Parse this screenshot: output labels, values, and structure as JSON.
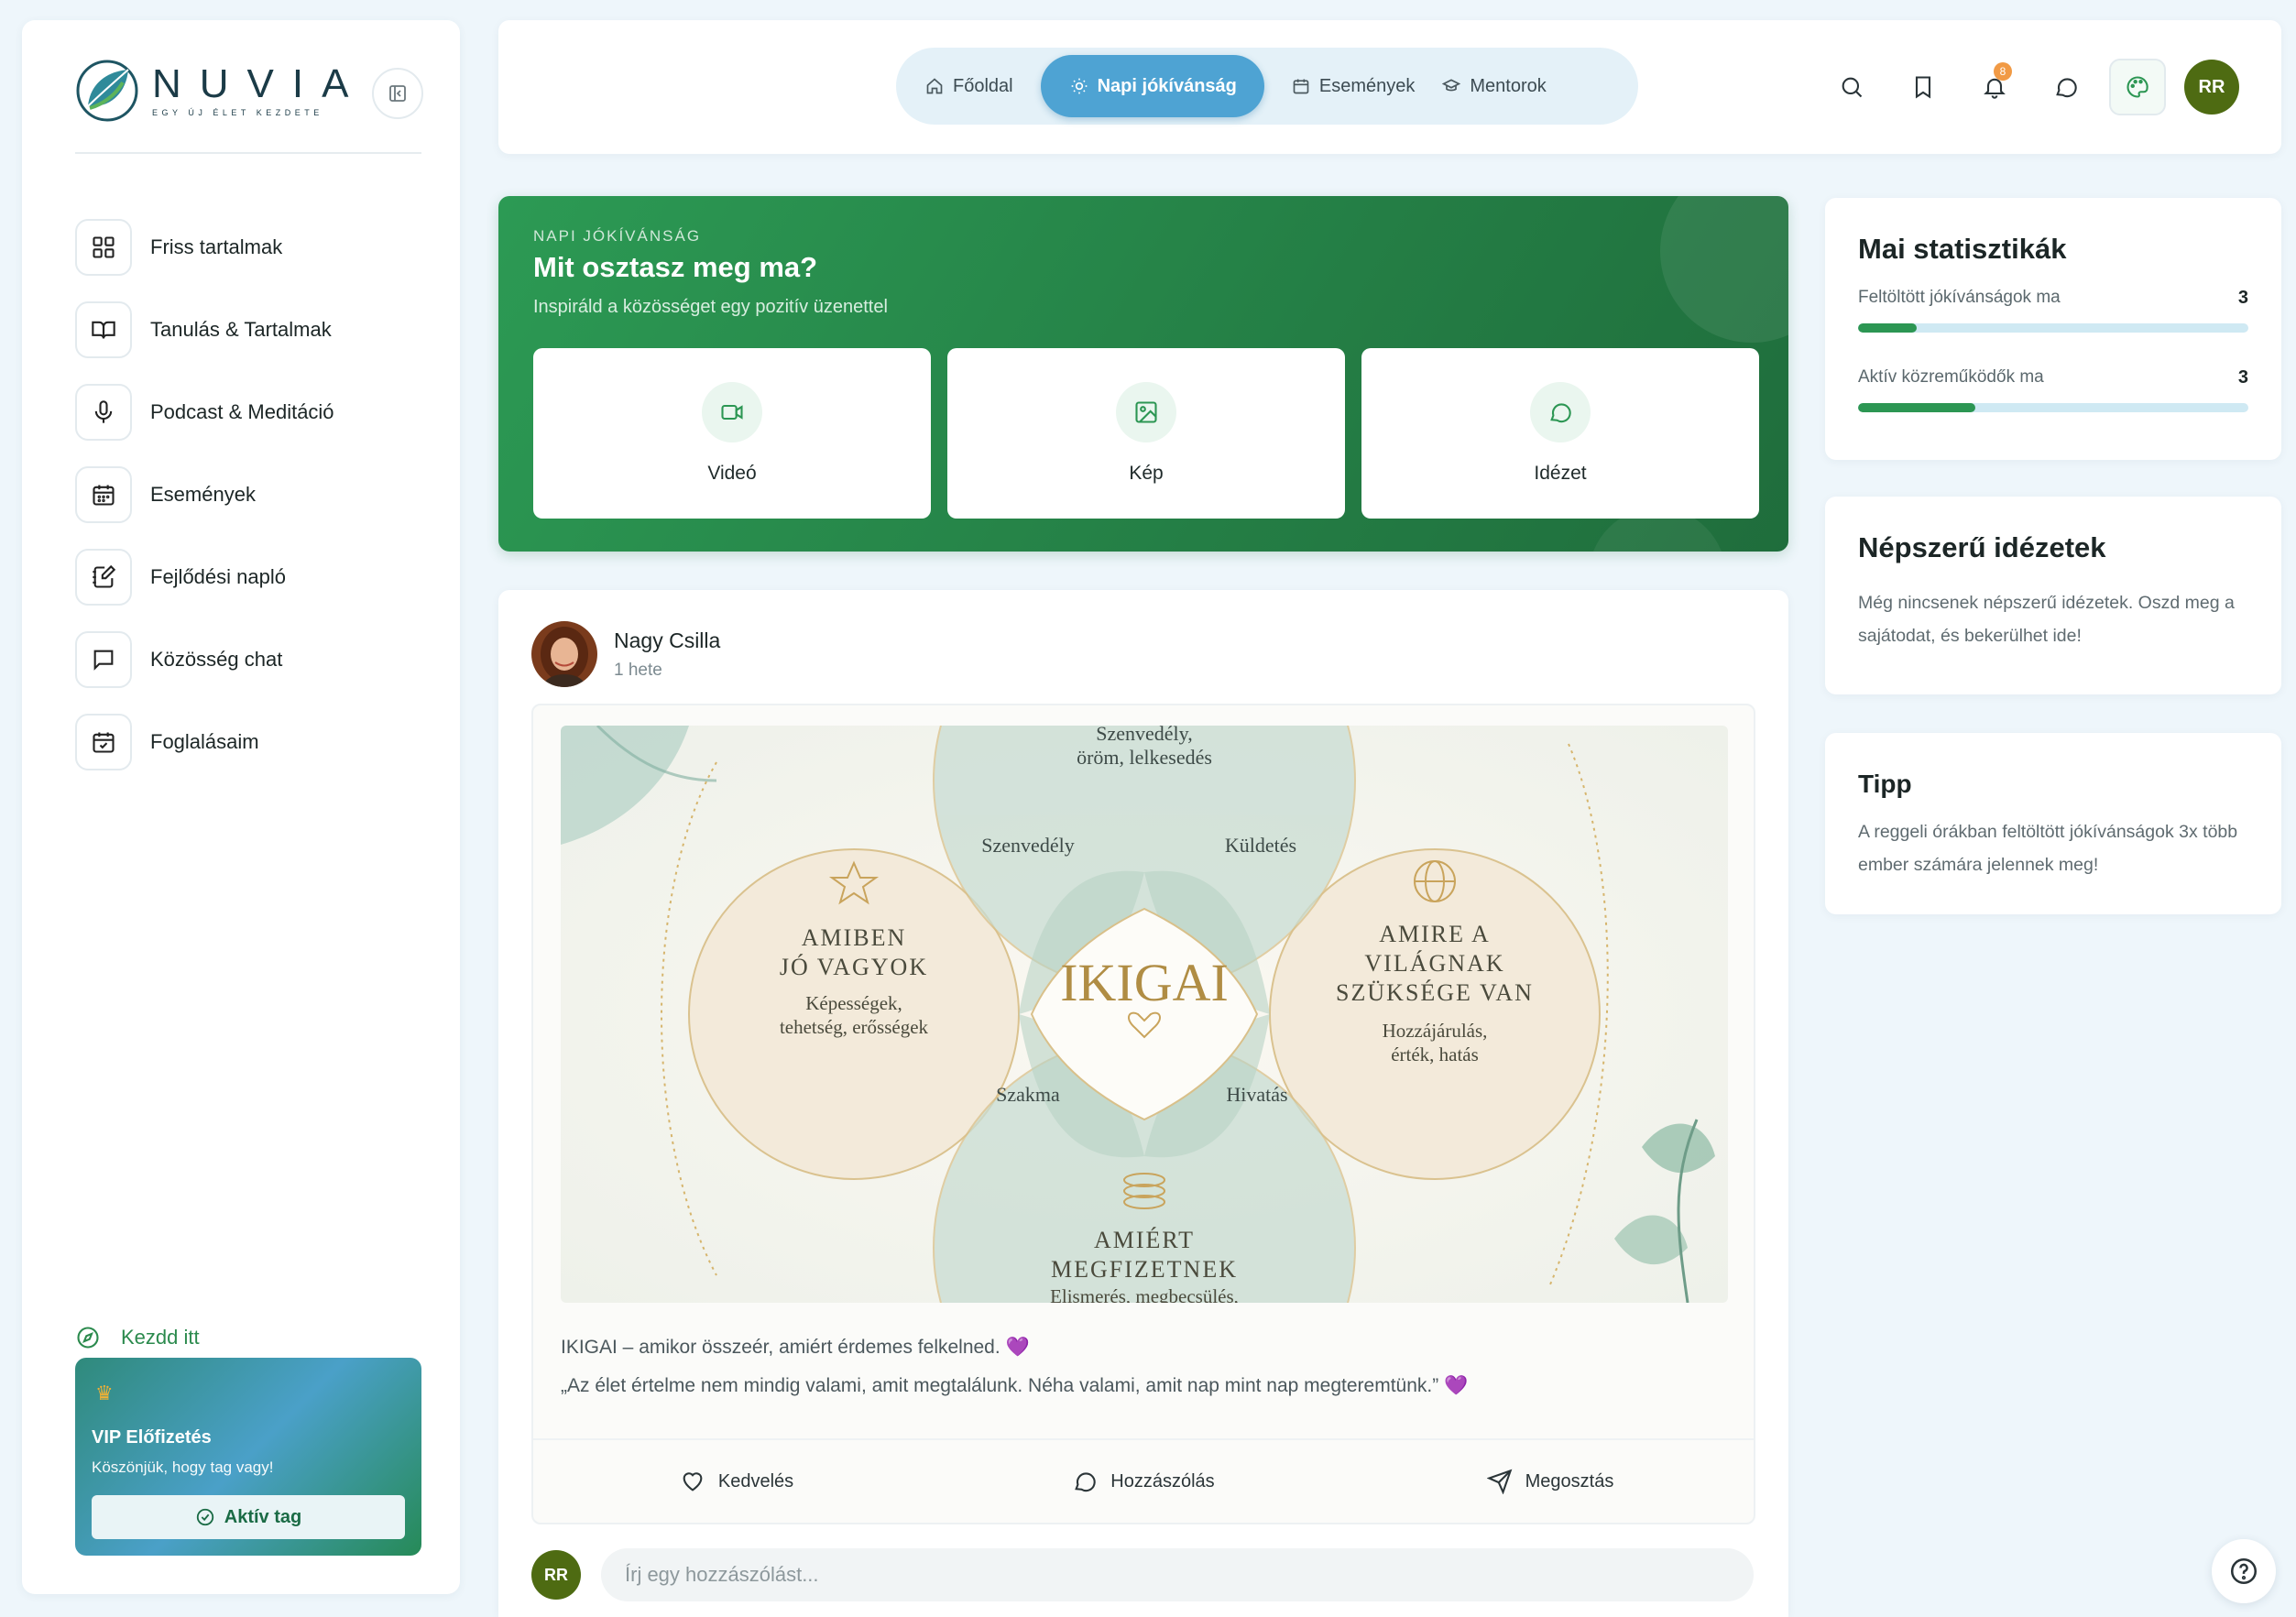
{
  "brand": {
    "name": "NUVIA",
    "tagline": "EGY ÚJ ÉLET KEZDETE"
  },
  "sidebar": {
    "items": [
      {
        "label": "Friss tartalmak",
        "icon": "grid-icon"
      },
      {
        "label": "Tanulás & Tartalmak",
        "icon": "book-open-icon"
      },
      {
        "label": "Podcast & Meditáció",
        "icon": "microphone-icon"
      },
      {
        "label": "Események",
        "icon": "calendar-icon"
      },
      {
        "label": "Fejlődési napló",
        "icon": "notebook-pen-icon"
      },
      {
        "label": "Közösség chat",
        "icon": "chat-square-icon"
      },
      {
        "label": "Foglalásaim",
        "icon": "calendar-check-icon"
      }
    ],
    "start_label": "Kezdd itt",
    "vip": {
      "title": "VIP Előfizetés",
      "subtitle": "Köszönjük, hogy tag vagy!",
      "button": "Aktív tag"
    }
  },
  "topbar": {
    "tabs": [
      {
        "label": "Főoldal",
        "icon": "home-icon",
        "active": false
      },
      {
        "label": "Napi jókívánság",
        "icon": "sun-icon",
        "active": true
      },
      {
        "label": "Események",
        "icon": "calendar-icon",
        "active": false
      },
      {
        "label": "Mentorok",
        "icon": "graduation-cap-icon",
        "active": false
      }
    ],
    "notification_count": "8",
    "user_initials": "RR"
  },
  "hero": {
    "kicker": "NAPI JÓKÍVÁNSÁG",
    "title": "Mit osztasz meg ma?",
    "subtitle": "Inspiráld a közösséget egy pozitív üzenettel",
    "options": [
      {
        "label": "Videó",
        "icon": "video-icon"
      },
      {
        "label": "Kép",
        "icon": "image-icon"
      },
      {
        "label": "Idézet",
        "icon": "quote-bubble-icon"
      }
    ]
  },
  "post": {
    "author": "Nagy Csilla",
    "time": "1 hete",
    "image": {
      "center": "IKIGAI",
      "top": "Szenvedély, öröm, lelkesedés",
      "left_title": "AMIBEN JÓ VAGYOK",
      "left_sub": "Képességek, tehetség, erősségek",
      "right_title": "AMIRE A VILÁGNAK SZÜKSÉGE VAN",
      "right_sub": "Hozzájárulás, érték, hatás",
      "bottom_title": "AMIÉRT MEGFIZETNEK",
      "bottom_sub": "Elismerés, megbecsülés,",
      "petal_tl": "Szenvedély",
      "petal_tr": "Küldetés",
      "petal_bl": "Szakma",
      "petal_br": "Hivatás"
    },
    "text_line1": "IKIGAI – amikor összeér, amiért érdemes felkelned. 💜",
    "text_line2": "„Az élet értelme nem mindig valami, amit megtalálunk. Néha valami, amit nap mint nap megteremtünk.” 💜",
    "actions": {
      "like": "Kedvelés",
      "comment": "Hozzászólás",
      "share": "Megosztás"
    },
    "comment_avatar": "RR",
    "comment_placeholder": "Írj egy hozzászólást..."
  },
  "stats": {
    "title": "Mai statisztikák",
    "rows": [
      {
        "label": "Feltöltött jókívánságok ma",
        "value": "3",
        "fill": 0.15
      },
      {
        "label": "Aktív közreműködők ma",
        "value": "3",
        "fill": 0.3
      }
    ]
  },
  "popular": {
    "title": "Népszerű idézetek",
    "text": "Még nincsenek népszerű idézetek. Oszd meg a sajátodat, és bekerülhet ide!"
  },
  "tip": {
    "title": "Tipp",
    "text": "A reggeli órákban feltöltött jókívánságok 3x több ember számára jelennek meg!"
  },
  "colors": {
    "accent_green": "#2c9653",
    "accent_blue": "#4ea3d3",
    "badge": "#f19a45",
    "avatar_bg": "#4e6b12"
  }
}
